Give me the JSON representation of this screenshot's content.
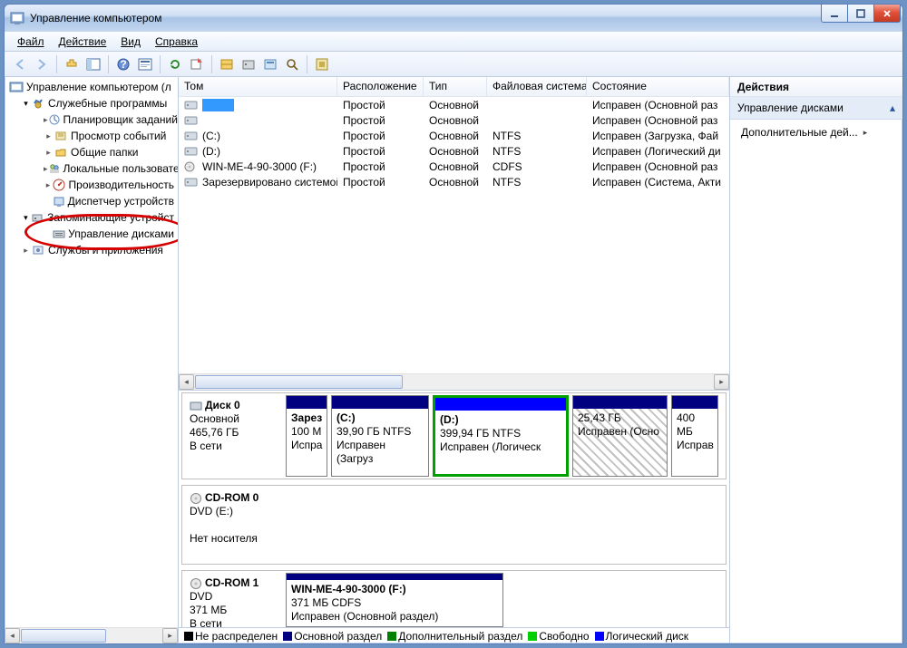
{
  "window": {
    "title": "Управление компьютером"
  },
  "menu": {
    "file": "Файл",
    "action": "Действие",
    "view": "Вид",
    "help": "Справка"
  },
  "tree": {
    "root": "Управление компьютером (л",
    "sys": "Служебные программы",
    "task": "Планировщик заданий",
    "event": "Просмотр событий",
    "shares": "Общие папки",
    "users": "Локальные пользовате",
    "perf": "Производительность",
    "dev": "Диспетчер устройств",
    "storage": "Запоминающие устройст",
    "diskmgmt": "Управление дисками",
    "svc": "Службы и приложения"
  },
  "columns": {
    "vol": "Том",
    "loc": "Расположение",
    "type": "Тип",
    "fs": "Файловая система",
    "state": "Состояние"
  },
  "volumes": [
    {
      "icon": "drive",
      "name": "",
      "loc": "Простой",
      "type": "Основной",
      "fs": "",
      "state": "Исправен (Основной раз",
      "selected": true
    },
    {
      "icon": "drive",
      "name": "",
      "loc": "Простой",
      "type": "Основной",
      "fs": "",
      "state": "Исправен (Основной раз"
    },
    {
      "icon": "drive",
      "name": "(C:)",
      "loc": "Простой",
      "type": "Основной",
      "fs": "NTFS",
      "state": "Исправен (Загрузка, Фай"
    },
    {
      "icon": "drive",
      "name": "(D:)",
      "loc": "Простой",
      "type": "Основной",
      "fs": "NTFS",
      "state": "Исправен (Логический ди"
    },
    {
      "icon": "cd",
      "name": "WIN-ME-4-90-3000 (F:)",
      "loc": "Простой",
      "type": "Основной",
      "fs": "CDFS",
      "state": "Исправен (Основной раз"
    },
    {
      "icon": "drive",
      "name": "Зарезервировано системой",
      "loc": "Простой",
      "type": "Основной",
      "fs": "NTFS",
      "state": "Исправен (Система, Акти"
    }
  ],
  "disk0": {
    "name": "Диск 0",
    "type": "Основной",
    "size": "465,76 ГБ",
    "status": "В сети",
    "parts": [
      {
        "title": "Зарез",
        "size": "100 М",
        "state": "Испра",
        "stripe": "primary",
        "w": 46
      },
      {
        "title": "(C:)",
        "size": "39,90 ГБ NTFS",
        "state": "Исправен (Загруз",
        "stripe": "primary",
        "w": 108
      },
      {
        "title": "(D:)",
        "size": "399,94 ГБ NTFS",
        "state": "Исправен (Логическ",
        "stripe": "logical",
        "w": 150,
        "selected": true
      },
      {
        "title": "",
        "size": "25,43 ГБ",
        "state": "Исправен (Осно",
        "stripe": "primary",
        "w": 105,
        "hatch": true
      },
      {
        "title": "",
        "size": "400 МБ",
        "state": "Исправ",
        "stripe": "primary",
        "w": 52
      }
    ]
  },
  "cd0": {
    "name": "CD-ROM 0",
    "type": "DVD (E:)",
    "status": "Нет носителя"
  },
  "cd1": {
    "name": "CD-ROM 1",
    "type": "DVD",
    "size": "371 МБ",
    "status": "В сети",
    "part": {
      "title": "WIN-ME-4-90-3000 (F:)",
      "size": "371 МБ CDFS",
      "state": "Исправен (Основной раздел)"
    }
  },
  "legend": {
    "unalloc": "Не распределен",
    "primary": "Основной раздел",
    "ext": "Дополнительный раздел",
    "free": "Свободно",
    "logical": "Логический диск"
  },
  "actions": {
    "title": "Действия",
    "section": "Управление дисками",
    "more": "Дополнительные дей..."
  }
}
